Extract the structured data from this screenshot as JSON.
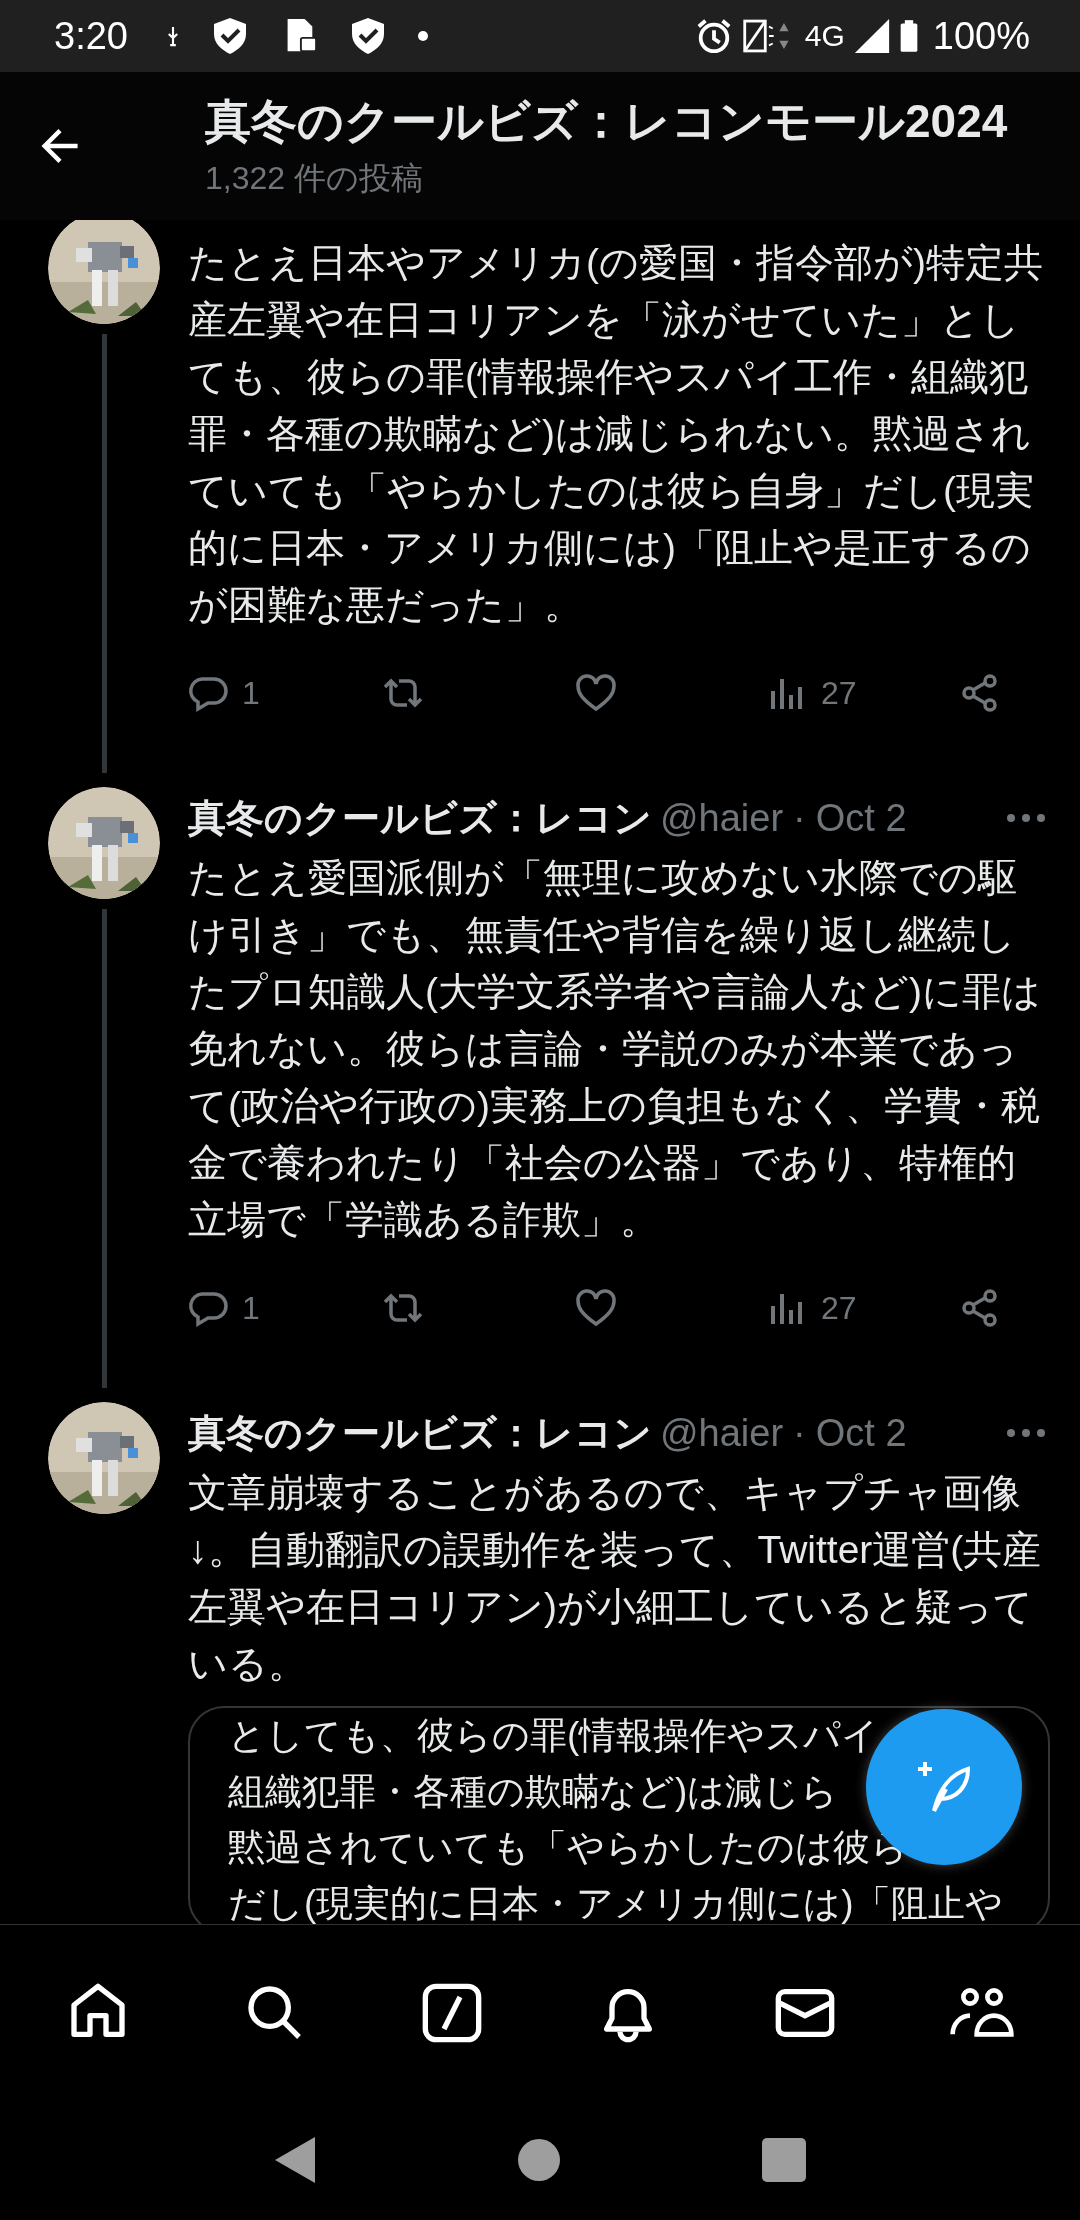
{
  "status_bar": {
    "time": "3:20",
    "network": "4G",
    "battery": "100%"
  },
  "header": {
    "title": "真冬のクールビズ：レコンモール2024",
    "subtitle": "1,322 件の投稿"
  },
  "tweets": [
    {
      "text": "たとえ日本やアメリカ(の愛国・指令部が)特定共産左翼や在日コリアンを「泳がせていた」としても、彼らの罪(情報操作やスパイ工作・組織犯罪・各種の欺瞞など)は減じられない。黙過されていても「やらかしたのは彼ら自身」だし(現実的に日本・アメリカ側には)「阻止や是正するのが困難な悪だった」。",
      "thread_line": true,
      "replies": "1",
      "views": "27"
    },
    {
      "name": "真冬のクールビズ：レコン",
      "handle": "@haier",
      "separator": "·",
      "date": "Oct 2",
      "text": "たとえ愛国派側が「無理に攻めない水際での駆け引き」でも、無責任や背信を繰り返し継続したプロ知識人(大学文系学者や言論人など)に罪は免れない。彼らは言論・学説のみが本業であって(政治や行政の)実務上の負担もなく、学費・税金で養われたり「社会の公器」であり、特権的立場で「学識ある詐欺」。",
      "thread_line": true,
      "replies": "1",
      "views": "27"
    },
    {
      "name": "真冬のクールビズ：レコン",
      "handle": "@haier",
      "separator": "·",
      "date": "Oct 2",
      "text": "文章崩壊することがあるので、キャプチャ画像↓。自動翻訳の誤動作を装って、Twitter運営(共産左翼や在日コリアン)が小細工していると疑っている。",
      "thread_line": false,
      "media": {
        "lines": [
          "としても、彼らの罪(情報操作やスパイ",
          "組織犯罪・各種の欺瞞など)は減じら",
          "黙過されていても「やらかしたのは彼ら",
          "だし(現実的に日本・アメリカ側には)「阻止や"
        ]
      }
    }
  ],
  "bottom_nav": {
    "items": [
      {
        "kind": "home"
      },
      {
        "kind": "search"
      },
      {
        "kind": "grok"
      },
      {
        "kind": "notifications"
      },
      {
        "kind": "messages"
      },
      {
        "kind": "communities"
      }
    ]
  }
}
